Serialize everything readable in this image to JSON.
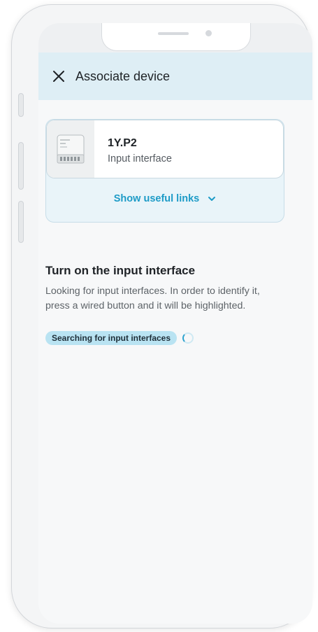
{
  "header": {
    "title": "Associate device",
    "close_icon": "close-icon"
  },
  "device": {
    "name": "1Y.P2",
    "type": "Input interface",
    "thumbnail_icon": "device-module-icon"
  },
  "links": {
    "label": "Show useful links",
    "icon": "chevron-down-icon"
  },
  "section": {
    "title": "Turn on the input interface",
    "description": "Looking for input interfaces. In order to identify it, press a wired button and it will be highlighted."
  },
  "status": {
    "label": "Searching for input interfaces",
    "indicator_icon": "spinner-icon"
  },
  "colors": {
    "header_bg": "#deeef5",
    "accent": "#1d9bc7",
    "pill_bg": "#b9e3f2"
  }
}
